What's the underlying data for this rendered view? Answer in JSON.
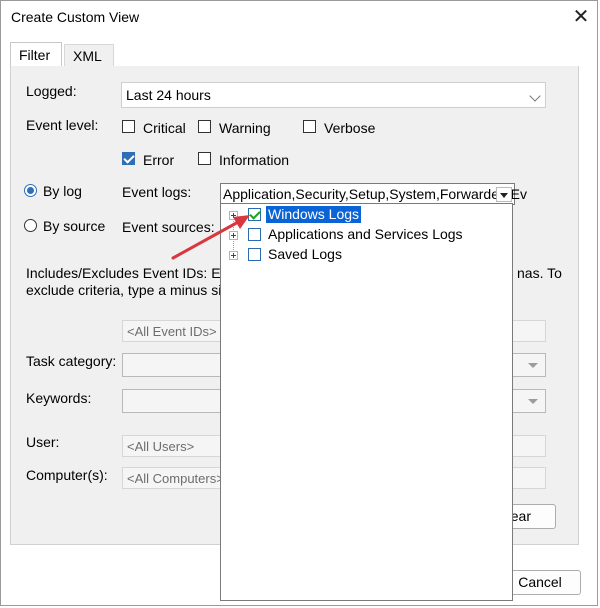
{
  "window": {
    "title": "Create Custom View",
    "close_glyph": "✕"
  },
  "tabs": [
    {
      "label": "Filter",
      "active": true
    },
    {
      "label": "XML",
      "active": false
    }
  ],
  "filter": {
    "logged_label": "Logged:",
    "logged_value": "Last 24 hours",
    "event_level_label": "Event level:",
    "levels": {
      "critical": {
        "label": "Critical",
        "checked": false
      },
      "warning": {
        "label": "Warning",
        "checked": false
      },
      "verbose": {
        "label": "Verbose",
        "checked": false
      },
      "error": {
        "label": "Error",
        "checked": true
      },
      "information": {
        "label": "Information",
        "checked": false
      }
    },
    "by_log_label": "By log",
    "by_source_label": "By source",
    "event_logs_label": "Event logs:",
    "event_logs_value": "Application,Security,Setup,System,Forwarded Ev",
    "event_sources_label": "Event sources:",
    "event_ids_note_left_1": "Includes/Excludes Event IDs: Ente",
    "event_ids_note_right_1": "nas. To",
    "event_ids_note_left_2": "exclude criteria, type a minus sign",
    "event_ids_placeholder": "<All Event IDs>",
    "task_category_label": "Task category:",
    "keywords_label": "Keywords:",
    "user_label": "User:",
    "user_placeholder": "<All Users>",
    "computers_label": "Computer(s):",
    "computers_placeholder": "<All Computers>",
    "clear_label_fragment": "ear",
    "cancel_label": "Cancel"
  },
  "log_tree": [
    {
      "label": "Windows Logs",
      "checked": true,
      "selected": true
    },
    {
      "label": "Applications and Services Logs",
      "checked": false,
      "selected": false
    },
    {
      "label": "Saved Logs",
      "checked": false,
      "selected": false
    }
  ],
  "colors": {
    "annotation_arrow": "#d9363e",
    "selection": "#0a64d6",
    "accent": "#2f6fb7"
  }
}
